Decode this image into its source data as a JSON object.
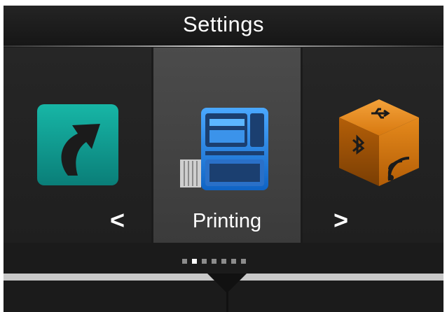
{
  "header": {
    "title": "Settings"
  },
  "carousel": {
    "items": [
      {
        "icon": "shortcut-arrow-icon",
        "label": ""
      },
      {
        "icon": "printer-icon",
        "label": "Printing"
      },
      {
        "icon": "interface-cube-icon",
        "label": ""
      }
    ],
    "prev_icon": "chevron-left-icon",
    "next_icon": "chevron-right-icon",
    "prev_glyph": "<",
    "next_glyph": ">",
    "page_count": 7,
    "current_page": 2
  },
  "colors": {
    "background": "#1b1b1b",
    "selected_panel": "#444444",
    "shortcut_teal": "#0f9a8f",
    "printer_blue": "#1e7fd8",
    "interface_orange": "#e07b10"
  }
}
